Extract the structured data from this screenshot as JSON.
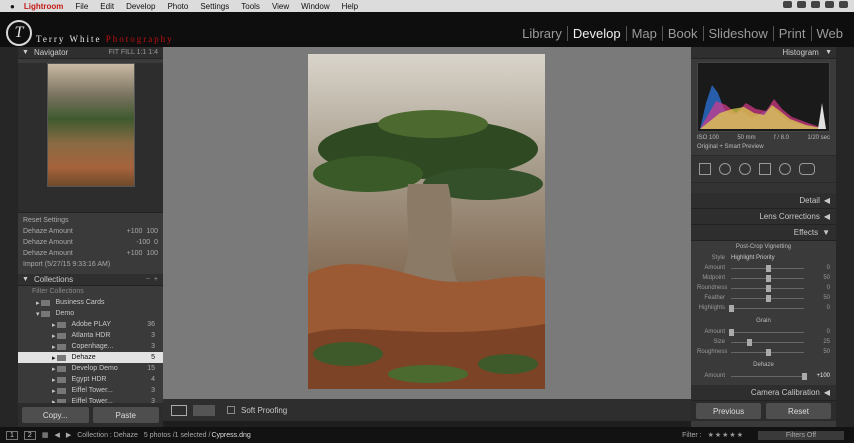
{
  "menubar": {
    "apple": "",
    "app": "Lightroom",
    "items": [
      "File",
      "Edit",
      "Develop",
      "Photo",
      "Settings",
      "Tools",
      "View",
      "Window",
      "Help"
    ]
  },
  "identity": {
    "name_part1": "Terry White ",
    "name_part2": "Photography",
    "mark": "T"
  },
  "modules": [
    "Library",
    "Develop",
    "Map",
    "Book",
    "Slideshow",
    "Print",
    "Web"
  ],
  "left": {
    "navigator": {
      "title": "Navigator",
      "zoom": "FIT  FILL  1:1  1:4"
    },
    "history": [
      {
        "name": "Reset Settings",
        "before": "",
        "after": ""
      },
      {
        "name": "Dehaze Amount",
        "before": "+100",
        "after": "100"
      },
      {
        "name": "Dehaze Amount",
        "before": "-100",
        "after": "0"
      },
      {
        "name": "Dehaze Amount",
        "before": "+100",
        "after": "100"
      },
      {
        "name": "Import (5/27/15 9:33:16 AM)",
        "before": "",
        "after": ""
      }
    ],
    "collections": {
      "title": "Collections",
      "filter": "Filter Collections",
      "items": [
        {
          "label": "Business Cards",
          "count": ""
        },
        {
          "label": "Demo",
          "count": ""
        },
        {
          "label": "Adobe PLAY",
          "count": "36"
        },
        {
          "label": "Atlanta HDR",
          "count": "3"
        },
        {
          "label": "Copenhage...",
          "count": "3"
        },
        {
          "label": "Dehaze",
          "count": "5"
        },
        {
          "label": "Develop Demo",
          "count": "15"
        },
        {
          "label": "Egypt HDR",
          "count": "4"
        },
        {
          "label": "Eiffel Tower...",
          "count": "3"
        },
        {
          "label": "Eiffel Tower...",
          "count": "3"
        }
      ]
    },
    "copy": "Copy...",
    "paste": "Paste"
  },
  "toolbar": {
    "soft_proofing": "Soft Proofing"
  },
  "right": {
    "histogram_title": "Histogram",
    "info": {
      "iso": "ISO 100",
      "focal": "50 mm",
      "aperture": "f / 8.0",
      "shutter": "1/20 sec"
    },
    "original": "Original + Smart Preview",
    "sections": {
      "detail": "Detail",
      "lens": "Lens Corrections",
      "effects": "Effects",
      "calibration": "Camera Calibration"
    },
    "vignette": {
      "title": "Post-Crop Vignetting",
      "style_label": "Style",
      "style_value": "Highlight Priority",
      "sliders": [
        {
          "label": "Amount",
          "value": "0",
          "pos": 0.5
        },
        {
          "label": "Midpoint",
          "value": "50",
          "pos": 0.5
        },
        {
          "label": "Roundness",
          "value": "0",
          "pos": 0.5
        },
        {
          "label": "Feather",
          "value": "50",
          "pos": 0.5
        },
        {
          "label": "Highlights",
          "value": "0",
          "pos": 0
        }
      ]
    },
    "grain": {
      "title": "Grain",
      "sliders": [
        {
          "label": "Amount",
          "value": "0",
          "pos": 0
        },
        {
          "label": "Size",
          "value": "25",
          "pos": 0.25
        },
        {
          "label": "Roughness",
          "value": "50",
          "pos": 0.5
        }
      ]
    },
    "dehaze": {
      "title": "Dehaze",
      "label": "Amount",
      "value": "+100",
      "pos": 1
    },
    "previous": "Previous",
    "reset": "Reset"
  },
  "filmstrip": {
    "views": [
      "1",
      "2"
    ],
    "breadcrumb": "Collection : Dehaze",
    "count": "5 photos /1 selected /",
    "file": "Cypress.dng",
    "filter_label": "Filter :",
    "filters_off": "Filters Off"
  },
  "colors": {
    "accent_red": "#c21b17",
    "panel_bg": "#3a3a3a",
    "center_bg": "#7a7a7a"
  }
}
